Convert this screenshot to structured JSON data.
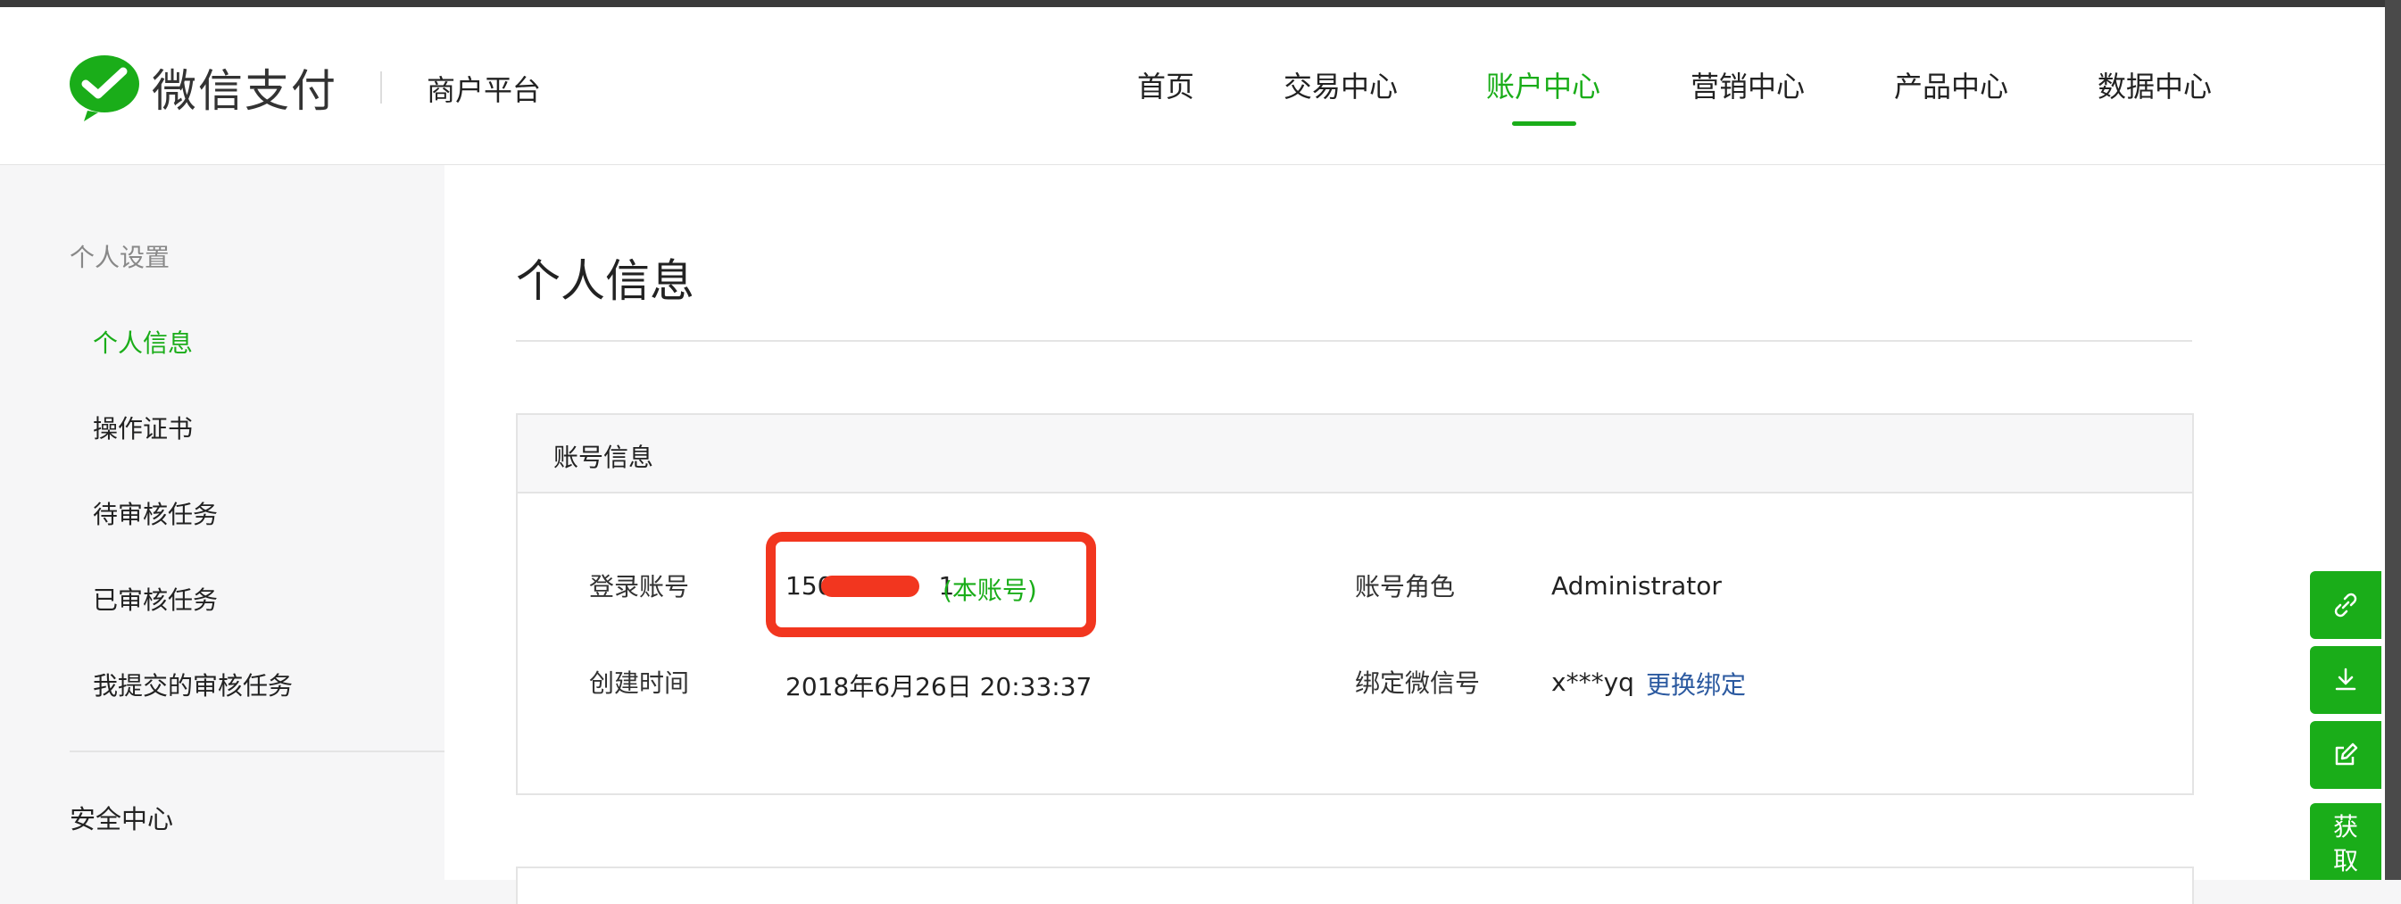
{
  "brand": {
    "logo_text": "微信支付",
    "platform": "商户平台"
  },
  "nav": [
    {
      "label": "首页",
      "active": false
    },
    {
      "label": "交易中心",
      "active": false
    },
    {
      "label": "账户中心",
      "active": true
    },
    {
      "label": "营销中心",
      "active": false
    },
    {
      "label": "产品中心",
      "active": false
    },
    {
      "label": "数据中心",
      "active": false
    }
  ],
  "sidebar": {
    "group_label": "个人设置",
    "items": [
      {
        "label": "个人信息",
        "active": true
      },
      {
        "label": "操作证书",
        "active": false
      },
      {
        "label": "待审核任务",
        "active": false
      },
      {
        "label": "已审核任务",
        "active": false
      },
      {
        "label": "我提交的审核任务",
        "active": false
      }
    ],
    "section_label": "安全中心"
  },
  "main": {
    "page_title": "个人信息",
    "account_card": {
      "title": "账号信息",
      "login_label": "登录账号",
      "login_value_prefix": "150",
      "login_value_suffix": "1",
      "login_tag": "(本账号)",
      "role_label": "账号角色",
      "role_value": "Administrator",
      "created_label": "创建时间",
      "created_value": "2018年6月26日 20:33:37",
      "wechat_label": "绑定微信号",
      "wechat_value": "x***yq",
      "wechat_action": "更换绑定"
    }
  },
  "floating_tools": {
    "buttons": [
      "link-icon",
      "download-icon",
      "edit-icon"
    ],
    "text_button": "获取"
  },
  "colors": {
    "accent": "#1aad19",
    "link": "#2c5aa0",
    "annotation": "#f2361f"
  }
}
